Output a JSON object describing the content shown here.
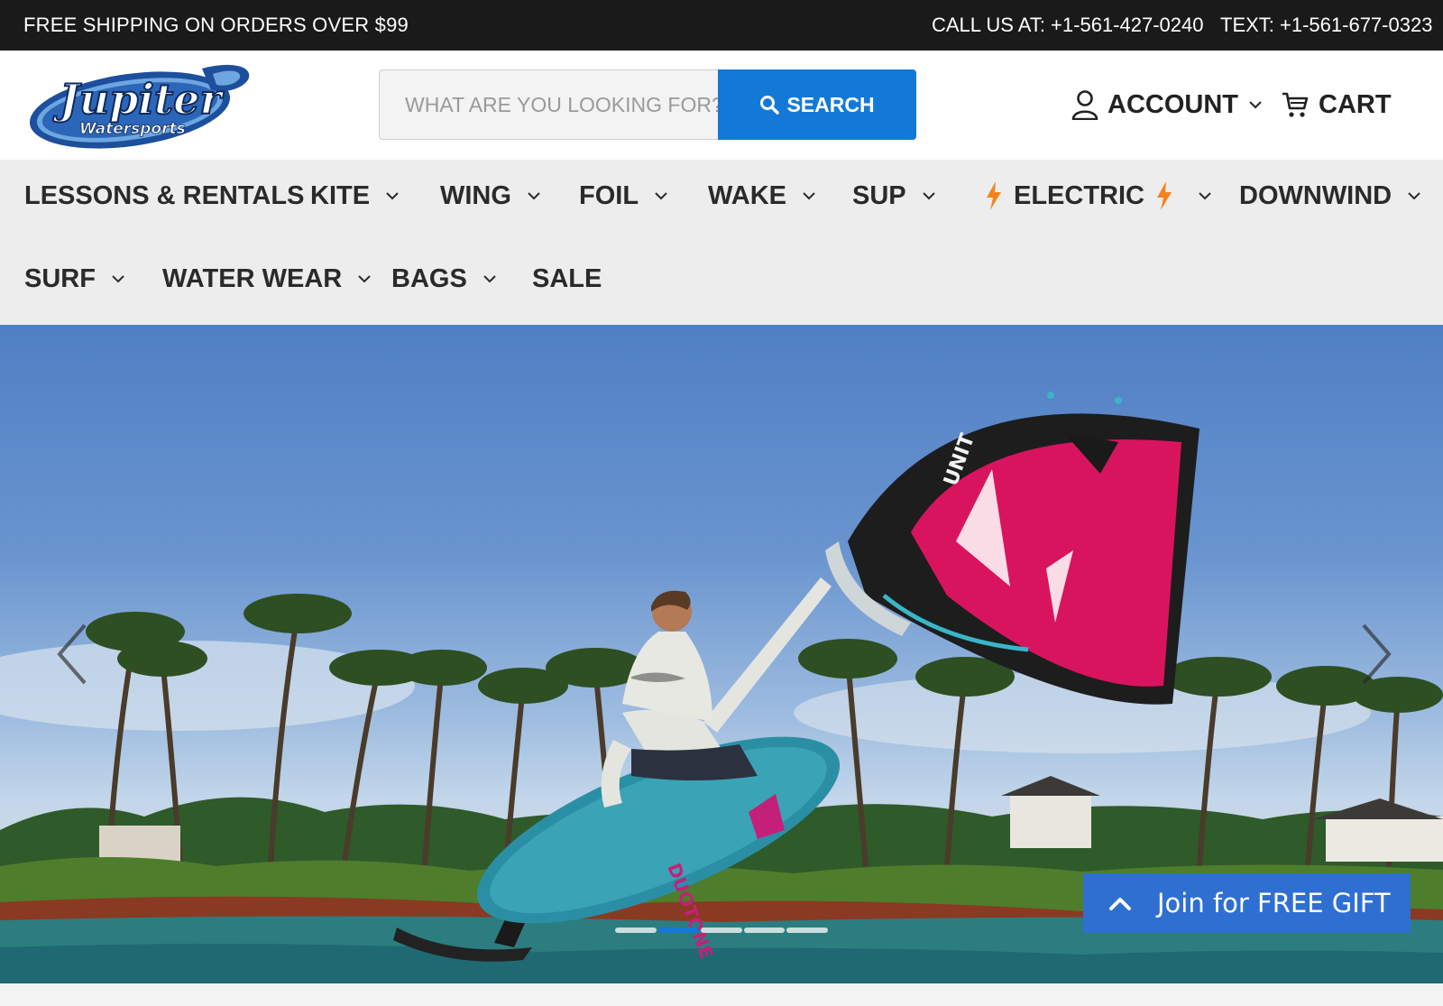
{
  "topbar": {
    "promo": "FREE SHIPPING ON ORDERS OVER $99",
    "call": "CALL US AT: +1-561-427-0240",
    "text": "TEXT: +1-561-677-0323"
  },
  "header": {
    "logo_text": "Jupiter",
    "logo_subtext": "Watersports",
    "search_placeholder": "WHAT ARE YOU LOOKING FOR?",
    "search_button": "SEARCH",
    "account_label": "ACCOUNT",
    "cart_label": "CART"
  },
  "nav": {
    "items": [
      {
        "label": "LESSONS & RENTALS"
      },
      {
        "label": "KITE"
      },
      {
        "label": "WING"
      },
      {
        "label": "FOIL"
      },
      {
        "label": "WAKE"
      },
      {
        "label": "SUP"
      },
      {
        "label": "ELECTRIC"
      },
      {
        "label": "DOWNWIND"
      },
      {
        "label": "SURF"
      },
      {
        "label": "WATER WEAR"
      },
      {
        "label": "BAGS"
      },
      {
        "label": "SALE"
      }
    ]
  },
  "hero": {
    "slide_count": 5,
    "active_slide": 2,
    "brand_on_board": "DUOTONE",
    "wing_text": "UNIT"
  },
  "gift": {
    "label": "Join for FREE GIFT"
  },
  "colors": {
    "topbar_bg": "#1a1a1a",
    "accent_blue": "#1479d6",
    "nav_bg": "#ededed",
    "bolt_orange": "#f5821f",
    "gift_blue": "#2f6fd2",
    "wing_magenta": "#d9145f"
  },
  "icons": {
    "search": "search-icon",
    "account": "user-icon",
    "cart": "cart-icon",
    "chevron": "chevron-down-icon",
    "bolt": "lightning-bolt-icon",
    "prev": "chevron-left-icon",
    "next": "chevron-right-icon",
    "gift_up": "chevron-up-icon"
  }
}
